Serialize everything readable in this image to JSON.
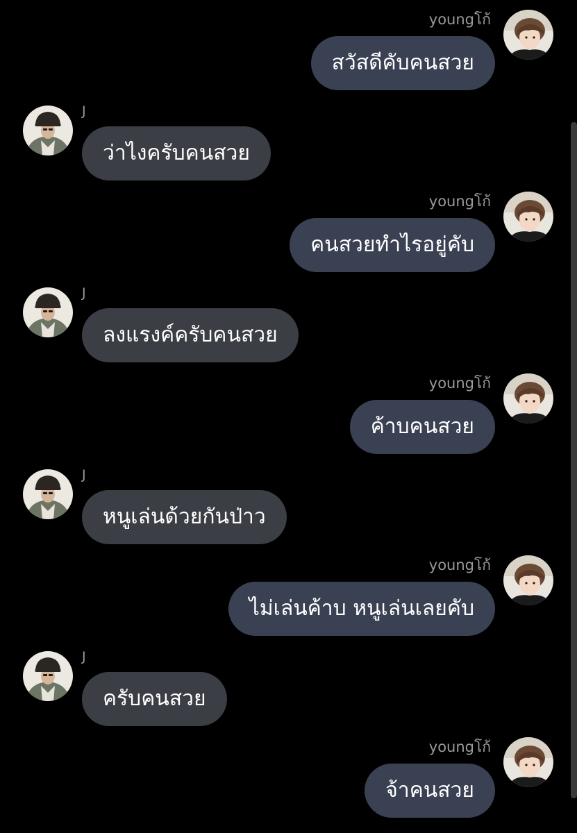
{
  "participants": {
    "me": {
      "name": "youngโก้",
      "avatar_icon": "avatar-young-photo"
    },
    "other": {
      "name": "J",
      "avatar_icon": "avatar-j-photo"
    }
  },
  "colors": {
    "background": "#000000",
    "my_bubble": "#3a4153",
    "their_bubble": "#3c3e46",
    "sender_name": "#9a9a9a",
    "message_text": "#ffffff"
  },
  "messages": [
    {
      "side": "right",
      "sender": "youngโก้",
      "text": "สวัสดีคับคนสวย"
    },
    {
      "side": "left",
      "sender": "J",
      "text": "ว่าไงครับคนสวย"
    },
    {
      "side": "right",
      "sender": "youngโก้",
      "text": "คนสวยทำไรอยู่คับ"
    },
    {
      "side": "left",
      "sender": "J",
      "text": "ลงแรงค์ครับคนสวย"
    },
    {
      "side": "right",
      "sender": "youngโก้",
      "text": "ค้าบคนสวย"
    },
    {
      "side": "left",
      "sender": "J",
      "text": "หนูเล่นด้วยกันป่าว"
    },
    {
      "side": "right",
      "sender": "youngโก้",
      "text": "ไม่เล่นค้าบ หนูเล่นเลยคับ"
    },
    {
      "side": "left",
      "sender": "J",
      "text": "ครับคนสวย"
    },
    {
      "side": "right",
      "sender": "youngโก้",
      "text": "จ้าคนสวย"
    }
  ]
}
